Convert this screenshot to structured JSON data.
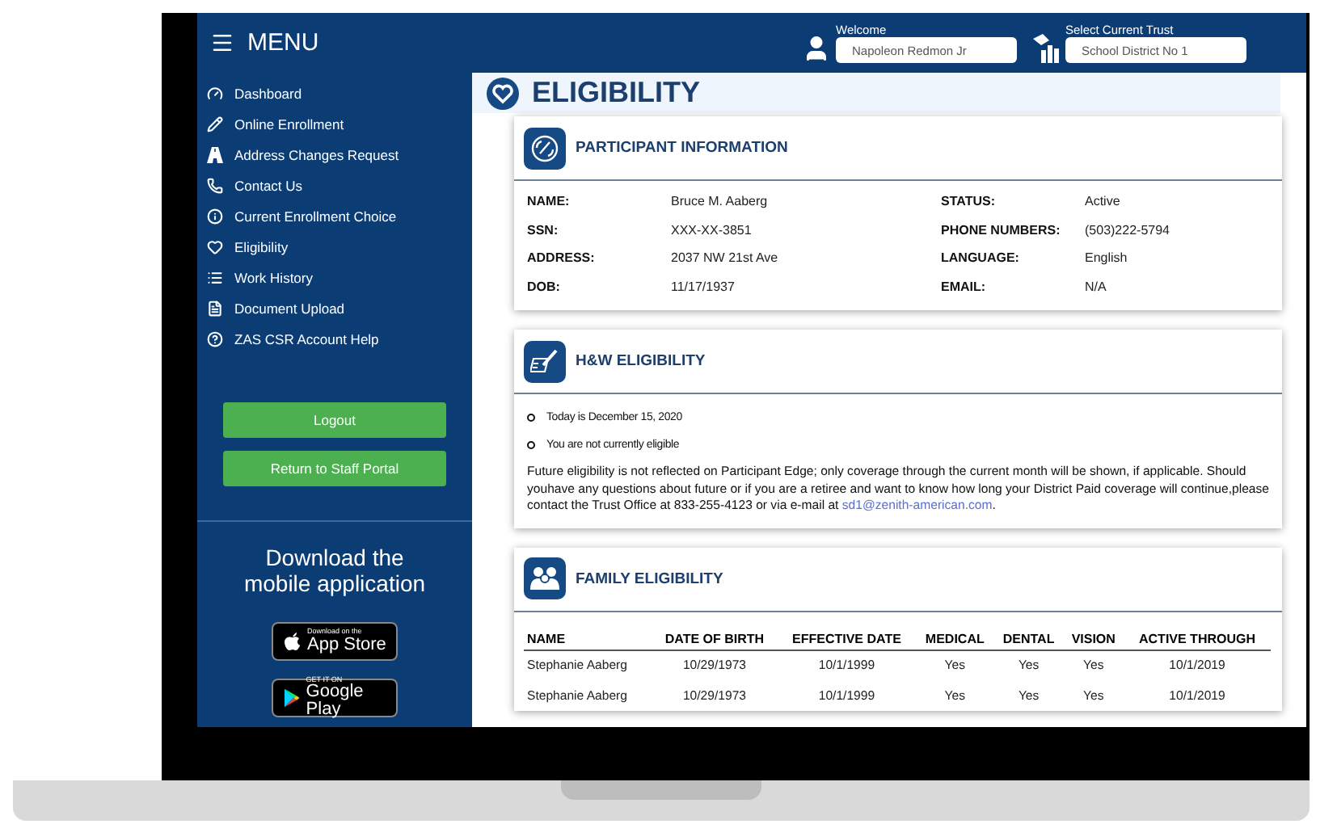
{
  "menu": {
    "title": "MENU",
    "items": [
      {
        "label": "Dashboard"
      },
      {
        "label": "Online Enrollment"
      },
      {
        "label": "Address Changes Request"
      },
      {
        "label": "Contact Us"
      },
      {
        "label": "Current Enrollment Choice"
      },
      {
        "label": "Eligibility"
      },
      {
        "label": "Work History"
      },
      {
        "label": "Document Upload"
      },
      {
        "label": "ZAS CSR Account Help"
      }
    ],
    "buttons": [
      "Logout",
      "Return to Staff Portal"
    ],
    "download": {
      "heading": "Download the mobile application",
      "badges": [
        {
          "kind": "apple",
          "small": "Download on the",
          "big": "App Store"
        },
        {
          "kind": "google",
          "small": "GET IT ON",
          "big": "Google Play"
        }
      ]
    }
  },
  "header": {
    "welcome_label": "Welcome",
    "user": "Napoleon Redmon Jr",
    "trust_label": "Select Current Trust",
    "trust": "School District No 1"
  },
  "page_title": "ELIGIBILITY",
  "participant": {
    "title": "PARTICIPANT INFORMATION",
    "fields": [
      {
        "label": "NAME:",
        "value": "Bruce M. Aaberg"
      },
      {
        "label": "STATUS:",
        "value": "Active"
      },
      {
        "label": "SSN:",
        "value": "XXX-XX-3851"
      },
      {
        "label": "PHONE NUMBERS:",
        "value": "(503)222-5794"
      },
      {
        "label": "ADDRESS:",
        "value": "2037 NW 21st Ave"
      },
      {
        "label": "LANGUAGE:",
        "value": "English"
      },
      {
        "label": "DOB:",
        "value": "11/17/1937"
      },
      {
        "label": "EMAIL:",
        "value": "N/A"
      }
    ]
  },
  "hw": {
    "title": "H&W ELIGIBILITY",
    "bullets": [
      "Today is December 15, 2020",
      "You are not currently eligible"
    ],
    "note": "Future eligibility is not reflected on Participant Edge; only coverage through the current month will be shown, if applicable. Should youhave any questions about future or if you are a retiree and want to know how long your District Paid coverage will continue,please contact the Trust Office at 833-255-4123 or via e-mail at",
    "link": "sd1@zenith-american.com",
    "note_end": "."
  },
  "family": {
    "title": "FAMILY ELIGIBILITY",
    "columns": [
      "NAME",
      "DATE OF BIRTH",
      "EFFECTIVE DATE",
      "MEDICAL",
      "DENTAL",
      "VISION",
      "ACTIVE THROUGH"
    ],
    "rows": [
      [
        "Stephanie Aaberg",
        "10/29/1973",
        "10/1/1999",
        "Yes",
        "Yes",
        "Yes",
        "10/1/2019"
      ],
      [
        "Stephanie Aaberg",
        "10/29/1973",
        "10/1/1999",
        "Yes",
        "Yes",
        "Yes",
        "10/1/2019"
      ]
    ]
  }
}
